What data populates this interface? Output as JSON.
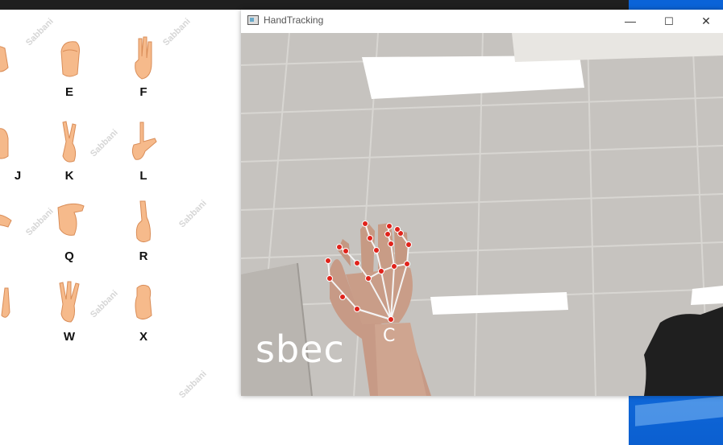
{
  "taskbar": {
    "color": "#1f1f1f"
  },
  "chart": {
    "letters": [
      "E",
      "F",
      "J",
      "K",
      "L",
      "Q",
      "R",
      "W",
      "X"
    ],
    "watermark": "Sabbani"
  },
  "window": {
    "title": "HandTracking",
    "controls": {
      "minimize": "—",
      "maximize": "☐",
      "close": "✕"
    },
    "recognized_text": "sbec",
    "predicted_letter": "C",
    "landmark_color": "#e0231b"
  }
}
